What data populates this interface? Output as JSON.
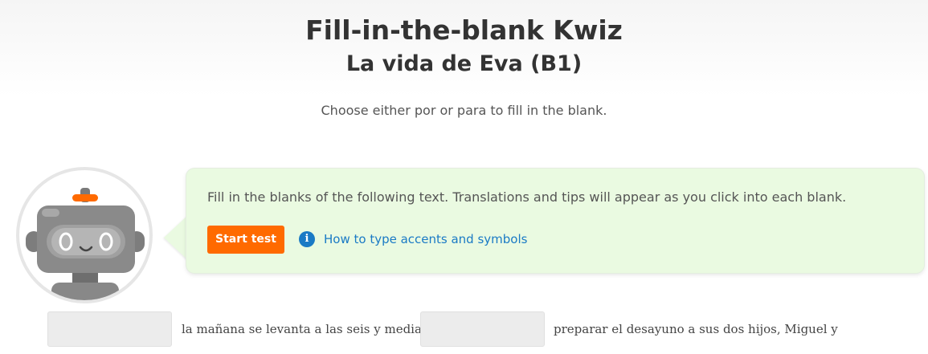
{
  "header": {
    "title": "Fill-in-the-blank Kwiz",
    "subtitle": "La vida de Eva (B1)",
    "instructions": "Choose either por or para to fill in the blank."
  },
  "bubble": {
    "text": "Fill in the blanks of the following text. Translations and tips will appear as you click into each blank.",
    "start_button_label": "Start test",
    "help_link_label": "How to type accents and symbols",
    "info_icon_glyph": "i"
  },
  "exercise": {
    "blanks": [
      {
        "value": "",
        "placeholder": ""
      },
      {
        "value": "",
        "placeholder": ""
      }
    ],
    "segments": [
      "la mañana se levanta a las seis y media",
      "preparar el desayuno a sus dos hijos, Miguel y"
    ]
  },
  "colors": {
    "accent_orange": "#ff6a00",
    "link_blue": "#1a7ac5",
    "bubble_green": "#eafae1"
  },
  "icons": {
    "avatar": "robot-icon",
    "help": "info-icon"
  }
}
